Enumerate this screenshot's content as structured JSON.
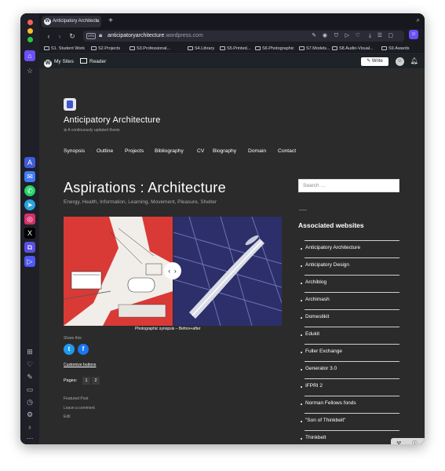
{
  "browser": {
    "tab_title": "Anticipatory Architectu",
    "url_domain": "anticipatoryarchitecture",
    "url_rest": ".wordpress.com",
    "vpn_label": "VPN",
    "bookmarks": [
      "S1. Student Work",
      "S2.Projects",
      "S3.Professional...",
      "S4.Library",
      "S5.Printed...",
      "S6.Photographic",
      "S7.Models...",
      "S8.Audio-Visual...",
      "S9.Awards"
    ]
  },
  "wp_admin": {
    "my_sites": "My Sites",
    "reader": "Reader",
    "write": "Write"
  },
  "site": {
    "title": "Anticipatory Architecture",
    "tagline": "⊕ A continuously updated thesis",
    "nav": [
      "Synopsis",
      "Outline",
      "Projects",
      "Bibliography",
      "CV",
      "Biography",
      "Domain",
      "Contact"
    ]
  },
  "post": {
    "title": "Aspirations : Architecture",
    "subtitle": "Energy, Health, Information, Learning, Movement, Pleasure, Shelter",
    "caption": "Photographic synopsis – Before+after",
    "share_label": "Share this:",
    "customize": "Customize buttons",
    "pages_label": "Pages:",
    "pages": [
      "1",
      "2"
    ],
    "meta": [
      "Featured Post",
      "Leave a comment",
      "Edit"
    ]
  },
  "sidebar_widget": {
    "search_placeholder": "Search …",
    "title": "Associated websites",
    "links": [
      "Anticipatory Architecture",
      "Anticipatory Design",
      "Archiblog",
      "Archimash",
      "Domestikit",
      "Edukit",
      "Fuller Exchange",
      "Generator 3.0",
      "IFPRI 2",
      "Norman Fellows fonds",
      "\"Son of Thinkbelt\"",
      "Thinkbelt"
    ]
  },
  "colors": {
    "page_bg": "#2b2b2b",
    "twitter": "#1d9bf0",
    "facebook": "#1877f2",
    "admin_bar": "#1d2327"
  }
}
